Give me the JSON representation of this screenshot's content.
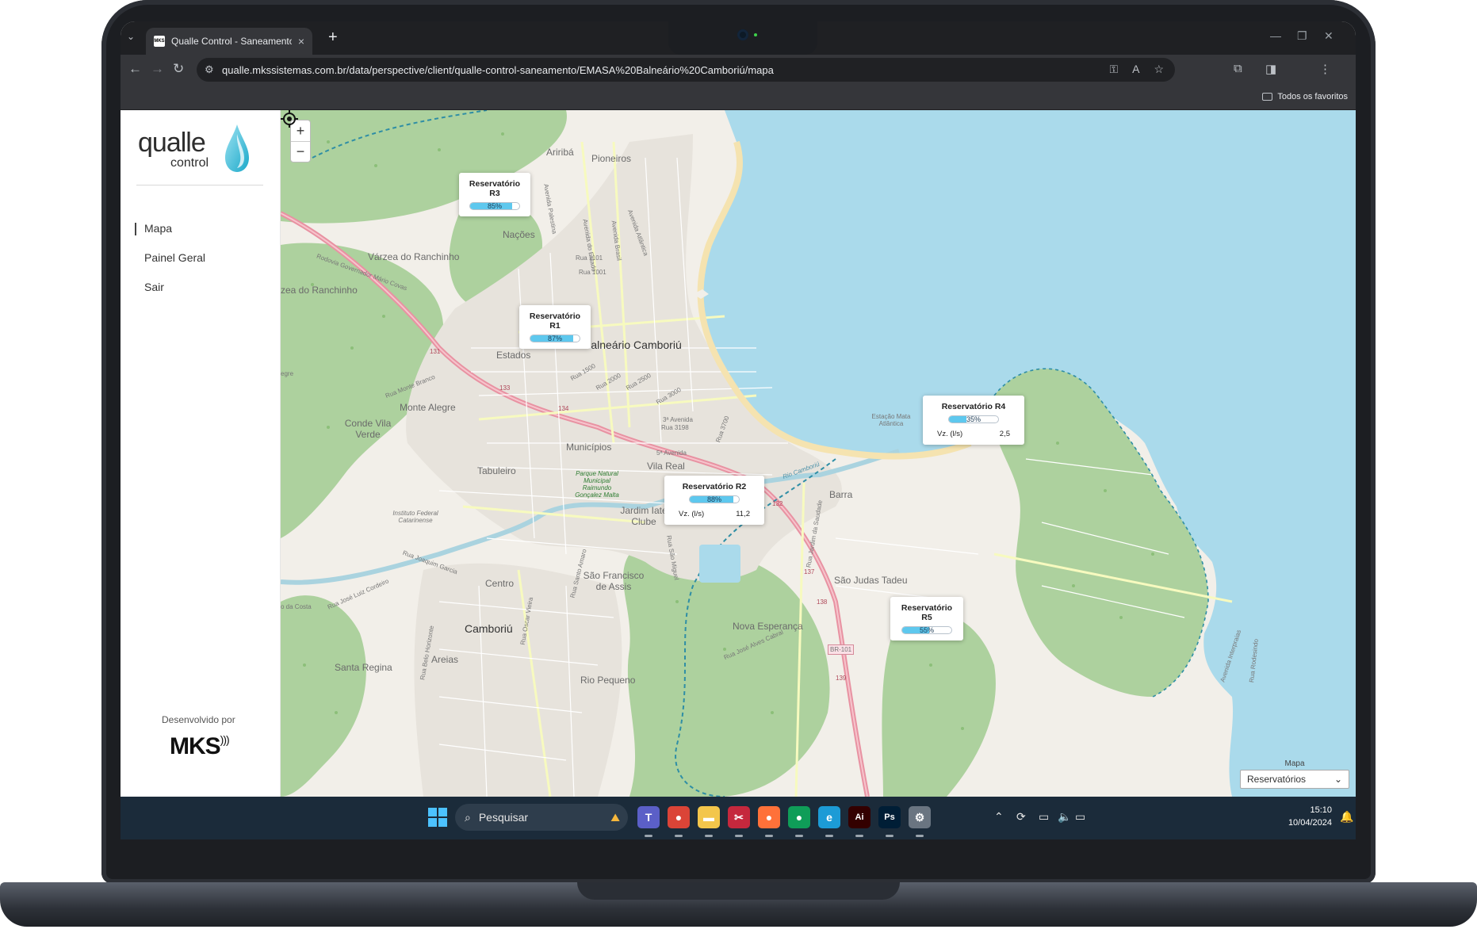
{
  "browser": {
    "tab_title": "Qualle Control - Saneamento",
    "favicon_text": "MKS",
    "url": "qualle.mkssistemas.com.br/data/perspective/client/qualle-control-saneamento/EMASA%20Balneário%20Camboriú/mapa",
    "bookmarks_label": "Todos os favoritos"
  },
  "sidebar": {
    "logo_word": "qualle",
    "logo_sub": "control",
    "items": [
      {
        "label": "Mapa",
        "active": true
      },
      {
        "label": "Painel Geral"
      },
      {
        "label": "Sair"
      }
    ],
    "developed_by": "Desenvolvido por",
    "dev_logo": "MKS"
  },
  "map": {
    "zoom_in": "+",
    "zoom_out": "−",
    "places": {
      "p1": "Ariribá",
      "p2": "Pioneiros",
      "p3": "Nações",
      "p4": "Várzea do Ranchinho",
      "p5": "zea do Ranchinho",
      "p6": "Estados",
      "p7": "Balneário Camboriú",
      "p8": "Monte Alegre",
      "p9": "Conde Vila Verde",
      "p10": "Tabuleiro",
      "p11": "Municípios",
      "p12": "Vila Real",
      "p13": "Jardim Iate Clube",
      "p14": "Barra",
      "p15": "São Judas Tadeu",
      "p16": "São Francisco de Assis",
      "p17": "Centro",
      "p18": "Camboriú",
      "p19": "Nova Esperança",
      "p20": "Areias",
      "p21": "Santa Regina",
      "p22": "Rio Pequeno",
      "p23": "Estação Mata Atlântica",
      "p24": "Parque Natural Municipal Raimundo Gonçalez Malta",
      "p25": "Instituto Federal Catarinense",
      "p26": "egre",
      "p27": "o da Costa"
    },
    "streets": {
      "s1": "Rodovia Governador Mário Covas",
      "s2": "Avenida do Estado",
      "s3": "Avenida Brasil",
      "s4": "Avenida Atlântica",
      "s5": "Rua 1101",
      "s6": "Rua 1001",
      "s7": "Rua 1500",
      "s8": "Rua 2000",
      "s9": "Rua 2500",
      "s10": "Rua 3000",
      "s11": "Rua 3198",
      "s12": "3ª Avenida",
      "s13": "5ª Avenida",
      "s14": "Rio Camboriú",
      "s15": "Rua Monte Branco",
      "s16": "Rua Joaquim Garcia",
      "s17": "Rua José Luiz Cordeiro",
      "s18": "BR-101",
      "s19": "Rua Oscar Vieira",
      "s20": "Rua Belo Horizonte",
      "s21": "Rua São Miguel",
      "s22": "Rua Santo Amaro",
      "s23": "Rua José Alves Cabral",
      "s24": "Avenida Palestina",
      "s25": "Rua 3700",
      "s26": "Rua Jardim da Saudade",
      "s27": "Avenida Interpraias",
      "s28": "Rua Rodesindo",
      "s29": "133",
      "s30": "134",
      "s31": "131",
      "s32": "132",
      "s33": "137",
      "s34": "138",
      "s35": "139"
    },
    "reservoirs": [
      {
        "name": "Reservatório R3",
        "level": 85,
        "level_label": "85%"
      },
      {
        "name": "Reservatório R1",
        "level": 87,
        "level_label": "87%"
      },
      {
        "name": "Reservatório R4",
        "level": 35,
        "level_label": "35%",
        "flow_label": "Vz. (l/s)",
        "flow_value": "2,5"
      },
      {
        "name": "Reservatório R2",
        "level": 88,
        "level_label": "88%",
        "flow_label": "Vz. (l/s)",
        "flow_value": "11,2"
      },
      {
        "name": "Reservatório R5",
        "level": 55,
        "level_label": "55%"
      }
    ],
    "layer_select": {
      "label": "Mapa",
      "value": "Reservatórios"
    }
  },
  "taskbar": {
    "search_placeholder": "Pesquisar",
    "time": "15:10",
    "date": "10/04/2024",
    "apps": [
      {
        "name": "teams",
        "glyph": "T",
        "color": "#5b5fc7"
      },
      {
        "name": "chrome",
        "glyph": "●",
        "color": "#db4437"
      },
      {
        "name": "explorer",
        "glyph": "▬",
        "color": "#f3c64b"
      },
      {
        "name": "snipping",
        "glyph": "✂",
        "color": "#c5283d"
      },
      {
        "name": "firefox",
        "glyph": "●",
        "color": "#ff7139"
      },
      {
        "name": "chrome-dev",
        "glyph": "●",
        "color": "#0f9d58"
      },
      {
        "name": "edge",
        "glyph": "e",
        "color": "#1c9bd6"
      },
      {
        "name": "illustrator",
        "glyph": "Ai",
        "color": "#330000"
      },
      {
        "name": "photoshop",
        "glyph": "Ps",
        "color": "#001e36"
      },
      {
        "name": "settings",
        "glyph": "⚙",
        "color": "#6a7581"
      }
    ]
  }
}
